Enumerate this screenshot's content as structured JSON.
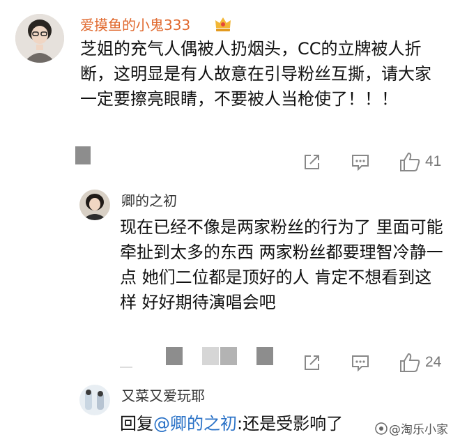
{
  "comment1": {
    "username": "爱摸鱼的小鬼333",
    "username_color": "#e0682d",
    "badge_icon": "crown-icon",
    "text": "芝姐的充气人偶被人扔烟头，CC的立牌被人折断，这明显是有人故意在引导粉丝互撕，请大家一定要擦亮眼睛，不要被人当枪使了！！！",
    "like_count": "41"
  },
  "reply1": {
    "username": "卿的之初",
    "text": "现在已经不像是两家粉丝的行为了 里面可能牵扯到太多的东西 两家粉丝都要理智冷静一点 她们二位都是顶好的人 肯定不想看到这样 好好期待演唱会吧",
    "like_count": "24"
  },
  "reply2": {
    "username": "又菜又爱玩耶",
    "reply_prefix": "回复",
    "mention": "@卿的之初",
    "text": ":还是受影响了"
  },
  "watermark": {
    "text": "@淘乐小家"
  },
  "icons": {
    "share": "share-icon",
    "comment": "comment-icon",
    "like": "thumbs-up-icon"
  },
  "colors": {
    "name_gray": "#333333",
    "count_gray": "#777777",
    "mention_blue": "#2a72c7"
  }
}
